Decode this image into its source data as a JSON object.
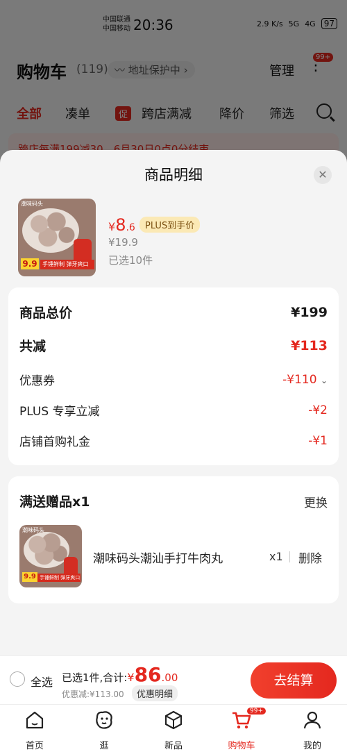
{
  "status_bar": {
    "carrier1": "中国联通",
    "carrier2": "中国移动",
    "time": "20:36",
    "speed": "2.9 K/s",
    "net1": "5G",
    "net2": "4G",
    "battery": "97"
  },
  "cart": {
    "title": "购物车",
    "count": "(119)",
    "address_protect": "地址保护中",
    "manage": "管理",
    "more_badge": "99+"
  },
  "filters": {
    "all": "全部",
    "fill_order": "凑单",
    "promo_tag": "促",
    "cross_store": "跨店满减",
    "price_drop": "降价",
    "filter": "筛选"
  },
  "promo_strip": "跨店每满199减30，6月30日0点0分结束",
  "sheet": {
    "title": "商品明细",
    "product": {
      "brand": "潮味码头",
      "price_currency": "¥",
      "price_int": "8",
      "price_dec": ".6",
      "plus_tag": "PLUS到手价",
      "original_price": "¥19.9",
      "selected": "已选10件",
      "thumb_price": "9.9",
      "thumb_banner": "手锤鲜制 弹牙爽口"
    },
    "summary": {
      "total_label": "商品总价",
      "total_value": "¥199",
      "cut_label": "共减",
      "cut_value": "¥113",
      "coupon_label": "优惠券",
      "coupon_value": "-¥110",
      "plus_label": "PLUS 专享立减",
      "plus_value": "-¥2",
      "shop_label": "店铺首购礼金",
      "shop_value": "-¥1"
    },
    "gift": {
      "title": "满送赠品x1",
      "change": "更换",
      "name": "潮味码头潮汕手打牛肉丸",
      "qty": "x1",
      "delete": "删除"
    }
  },
  "checkout": {
    "select_all": "全选",
    "selected_prefix": "已选1件,合计:",
    "total_currency": "¥",
    "total_int": "86",
    "total_dec": ".00",
    "discount": "优惠减:¥113.00",
    "detail": "优惠明细",
    "pay": "去结算"
  },
  "tabbar": {
    "home": "首页",
    "browse": "逛",
    "new": "新品",
    "cart": "购物车",
    "cart_badge": "99+",
    "mine": "我的"
  },
  "colors": {
    "accent": "#e4281f",
    "plus_tag_bg": "#fbe9b5"
  }
}
